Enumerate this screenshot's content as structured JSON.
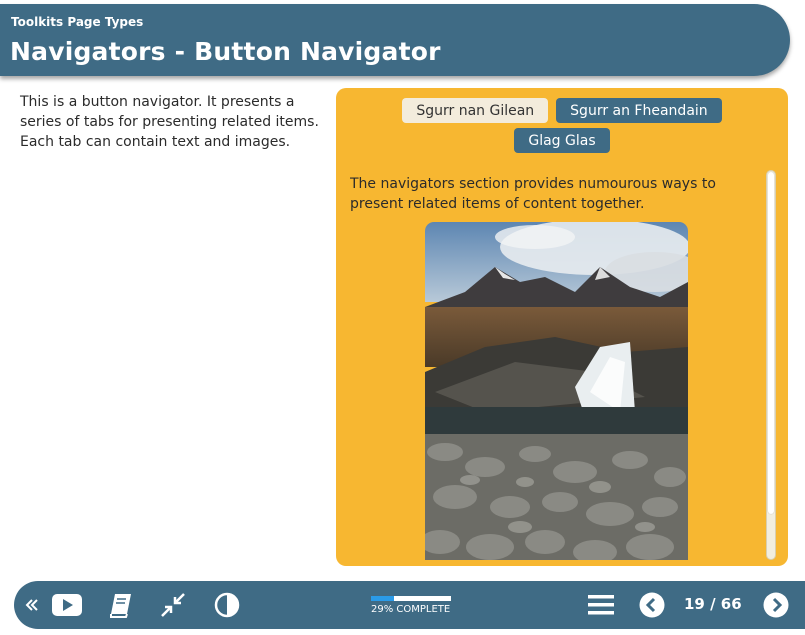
{
  "header": {
    "subtitle": "Toolkits Page Types",
    "title": "Navigators - Button Navigator"
  },
  "intro": {
    "text": "This is a button navigator. It presents a series of tabs for presenting related items. Each tab can contain text and images."
  },
  "navigator": {
    "tabs": [
      {
        "label": "Sgurr nan Gilean",
        "active": true
      },
      {
        "label": "Sgurr an Fheandain",
        "active": false
      },
      {
        "label": "Glag Glas",
        "active": false
      }
    ],
    "content_text": "The navigators section provides numourous ways to present related items of content together.",
    "image": "mountain-waterfall-photo"
  },
  "footer": {
    "progress_percent": 29,
    "progress_label": "29% COMPLETE",
    "page_indicator": "19 / 66",
    "icons": [
      "collapse-left-icon",
      "play-icon",
      "book-icon",
      "minimize-icon",
      "contrast-icon",
      "menu-icon",
      "previous-icon",
      "next-icon"
    ]
  },
  "colors": {
    "primary": "#3f6b85",
    "panel": "#f7b731",
    "active_tab": "#f3ecdc",
    "progress_fill": "#2a9be8"
  }
}
